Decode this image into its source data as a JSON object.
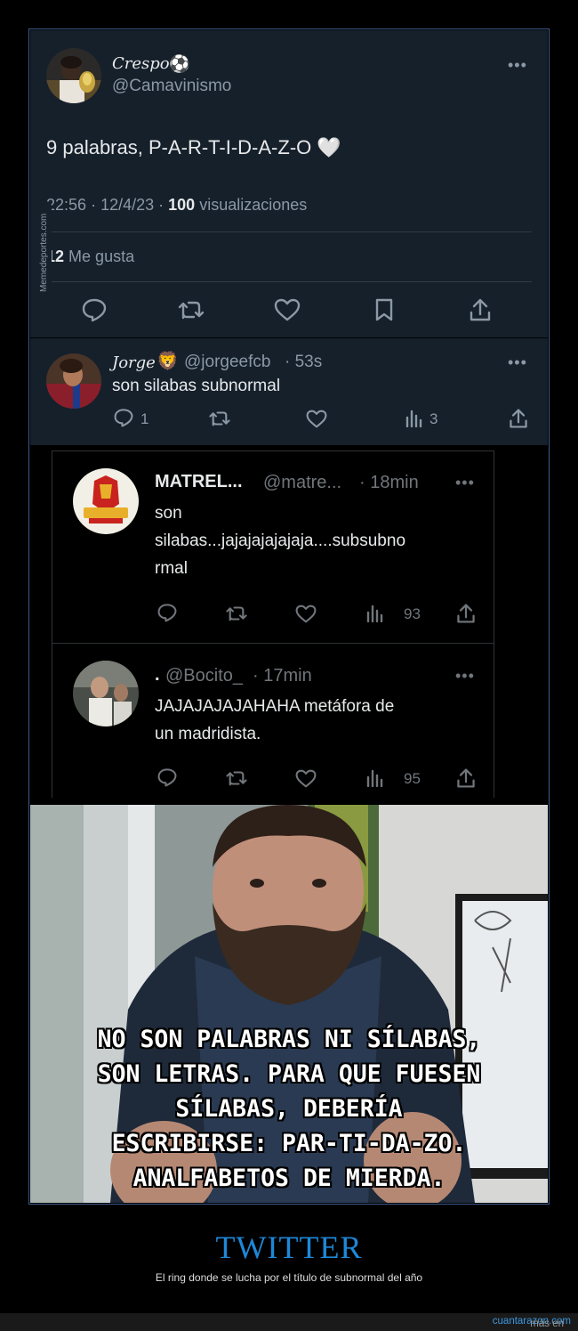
{
  "main_tweet": {
    "display_name": "Crespo",
    "display_emoji": "⚽",
    "handle": "@Camavinismo",
    "text": "9 palabras, P-A-R-T-I-D-A-Z-O 🤍",
    "time": "22:56",
    "date": "12/4/23",
    "views_count": "100",
    "views_label": "visualizaciones",
    "likes_count": "12",
    "likes_label": "Me gusta",
    "more_label": "•••"
  },
  "watermark": "Memedeportes.com",
  "reply": {
    "display_name": "Jorge",
    "display_emoji": "🦁",
    "handle": "@jorgeefcb",
    "time": "· 53s",
    "text": "son silabas subnormal",
    "reply_count": "1",
    "views_count": "3",
    "more_label": "•••"
  },
  "embedded": {
    "tweet1": {
      "name": "MATREL...",
      "handle": "@matre...",
      "time": "· 18min",
      "line1": "son",
      "line2": "silabas...jajajajajajaja....subsubno",
      "line3": "rmal",
      "views": "93",
      "more_label": "•••"
    },
    "tweet2": {
      "name": ".",
      "handle": "@Bocito_",
      "time": "· 17min",
      "line1": "JAJAJAJAJAHAHA metáfora de",
      "line2": "un madridista.",
      "views": "95",
      "more_label": "•••"
    }
  },
  "meme_caption": {
    "line1": "NO SON PALABRAS NI SÍLABAS,",
    "line2": "SON LETRAS. PARA QUE FUESEN",
    "line3": "SÍLABAS, DEBERÍA",
    "line4": "ESCRIBIRSE: PAR-TI-DA-ZO.",
    "line5": "ANALFABETOS DE MIERDA."
  },
  "footer": {
    "title": "TWITTER",
    "subtitle": "El ring donde se lucha por el título de subnormal del año",
    "more_prefix": "más en",
    "site": "cuantarazon.com"
  },
  "colors": {
    "tweet_bg": "#15202b",
    "accent": "#1e88d8",
    "muted": "#8b98a5"
  }
}
